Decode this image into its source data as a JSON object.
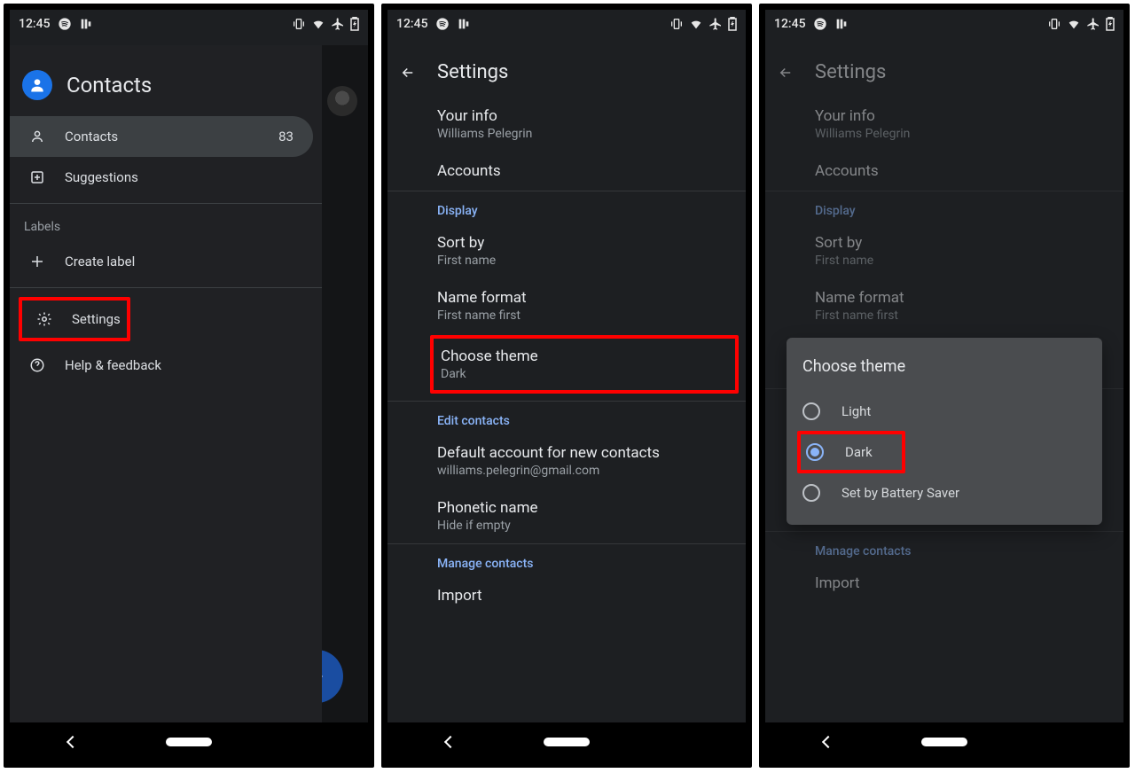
{
  "status": {
    "time": "12:45"
  },
  "screen1": {
    "app_title": "Contacts",
    "nav": {
      "contacts_label": "Contacts",
      "contacts_count": "83",
      "suggestions_label": "Suggestions",
      "labels_header": "Labels",
      "create_label": "Create label",
      "settings_label": "Settings",
      "help_label": "Help & feedback"
    }
  },
  "screen2": {
    "title": "Settings",
    "your_info": {
      "title": "Your info",
      "sub": "Williams Pelegrin"
    },
    "accounts": {
      "title": "Accounts"
    },
    "display_header": "Display",
    "sort_by": {
      "title": "Sort by",
      "sub": "First name"
    },
    "name_format": {
      "title": "Name format",
      "sub": "First name first"
    },
    "choose_theme": {
      "title": "Choose theme",
      "sub": "Dark"
    },
    "edit_header": "Edit contacts",
    "default_account": {
      "title": "Default account for new contacts",
      "sub": "williams.pelegrin@gmail.com"
    },
    "phonetic": {
      "title": "Phonetic name",
      "sub": "Hide if empty"
    },
    "manage_header": "Manage contacts",
    "import": {
      "title": "Import"
    }
  },
  "dialog": {
    "title": "Choose theme",
    "options": {
      "light": "Light",
      "dark": "Dark",
      "battery": "Set by Battery Saver"
    },
    "selected": "dark"
  }
}
